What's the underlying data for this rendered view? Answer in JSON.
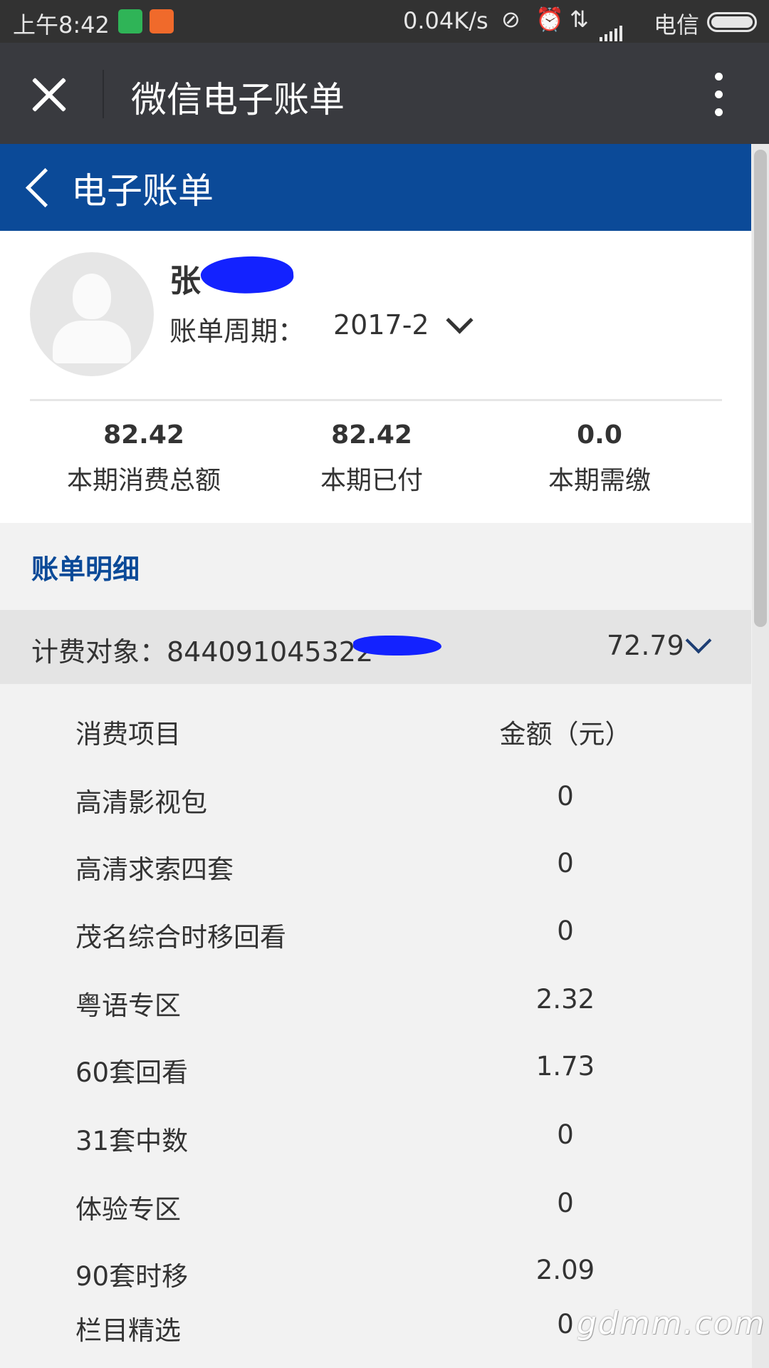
{
  "status_bar": {
    "time": "上午8:42",
    "net_speed": "0.04K/s",
    "carrier": "电信",
    "icons": [
      "shield-app-icon",
      "health-app-icon",
      "link-icon",
      "alarm-icon",
      "data-transfer-icon",
      "signal-icon",
      "battery-icon"
    ]
  },
  "webview": {
    "title": "微信电子账单"
  },
  "header": {
    "title": "电子账单"
  },
  "profile": {
    "name": "张",
    "period_label": "账单周期：",
    "period_value": "2017-2"
  },
  "summary": [
    {
      "value": "82.42",
      "label": "本期消费总额"
    },
    {
      "value": "82.42",
      "label": "本期已付"
    },
    {
      "value": "0.0",
      "label": "本期需缴"
    }
  ],
  "detail": {
    "title": "账单明细",
    "object_label": "计费对象：844091045322",
    "object_amount": "72.79",
    "columns": {
      "item": "消费项目",
      "amount": "金额（元）"
    },
    "rows": [
      {
        "item": "高清影视包",
        "amount": "0"
      },
      {
        "item": "高清求索四套",
        "amount": "0"
      },
      {
        "item": "茂名综合时移回看",
        "amount": "0"
      },
      {
        "item": "粤语专区",
        "amount": "2.32"
      },
      {
        "item": "60套回看",
        "amount": "1.73"
      },
      {
        "item": "31套中数",
        "amount": "0"
      },
      {
        "item": "体验专区",
        "amount": "0"
      },
      {
        "item": "90套时移",
        "amount": "2.09"
      },
      {
        "item": "栏目精选",
        "amount": "0"
      }
    ]
  },
  "watermark": "gdmm.com",
  "colors": {
    "brand_blue": "#0b4a98",
    "titlebar": "#393a3f",
    "statusbar": "#323232"
  }
}
